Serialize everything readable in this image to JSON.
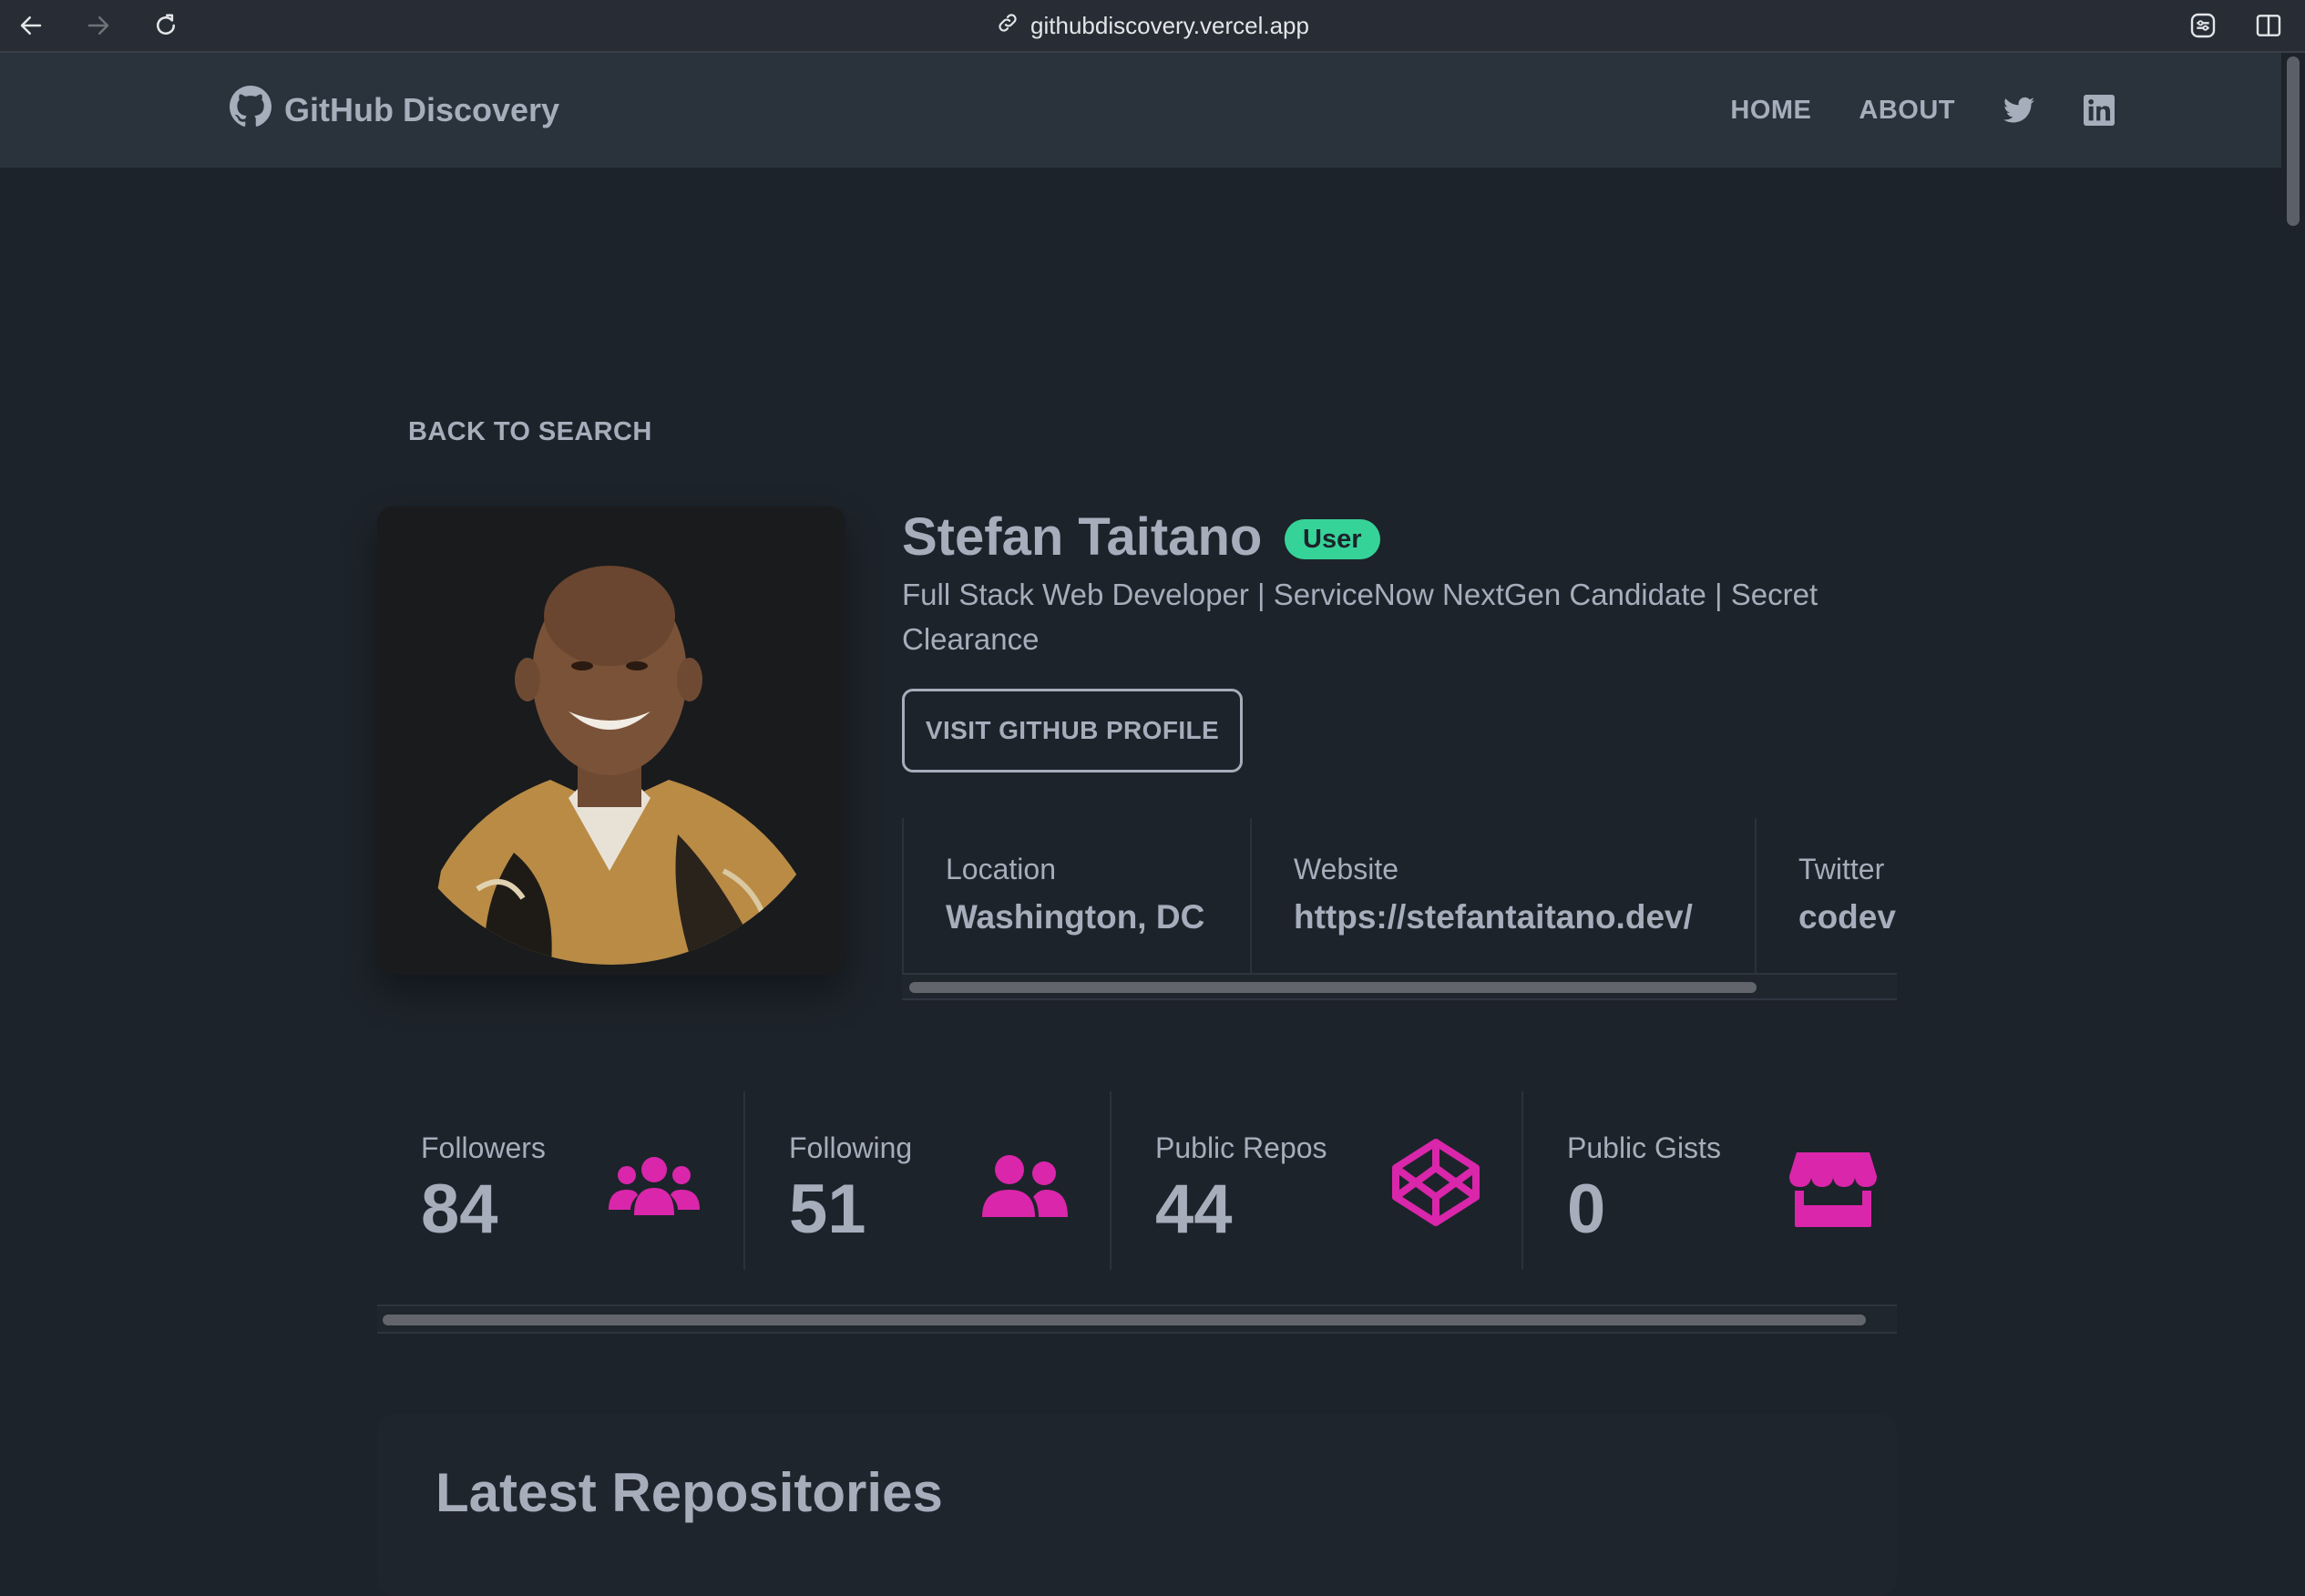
{
  "browser": {
    "url": "githubdiscovery.vercel.app",
    "icons": [
      "back-arrow-icon",
      "forward-arrow-icon",
      "reload-icon",
      "link-icon",
      "extension-icon",
      "sidebar-icon"
    ]
  },
  "navbar": {
    "brand": "GitHub Discovery",
    "links": [
      "HOME",
      "ABOUT"
    ],
    "social_icons": [
      "twitter-icon",
      "linkedin-icon"
    ]
  },
  "back_link": "BACK TO SEARCH",
  "profile": {
    "name": "Stefan Taitano",
    "type_badge": "User",
    "bio": "Full Stack Web Developer | ServiceNow NextGen Candidate | Secret Clearance",
    "visit_button": "VISIT GITHUB PROFILE",
    "info": [
      {
        "label": "Location",
        "value": "Washington, DC"
      },
      {
        "label": "Website",
        "value": "https://stefantaitano.dev/"
      },
      {
        "label": "Twitter",
        "value": "codev"
      }
    ]
  },
  "stats": [
    {
      "label": "Followers",
      "value": "84",
      "icon": "users-icon"
    },
    {
      "label": "Following",
      "value": "51",
      "icon": "user-friends-icon"
    },
    {
      "label": "Public Repos",
      "value": "44",
      "icon": "codepen-icon"
    },
    {
      "label": "Public Gists",
      "value": "0",
      "icon": "store-icon"
    }
  ],
  "repos_section": {
    "title": "Latest Repositories"
  },
  "colors": {
    "background": "#1d232a",
    "navbar": "#2a323c",
    "text": "#a6adbb",
    "badge": "#36d399",
    "stat_icon": "#d926aa"
  }
}
